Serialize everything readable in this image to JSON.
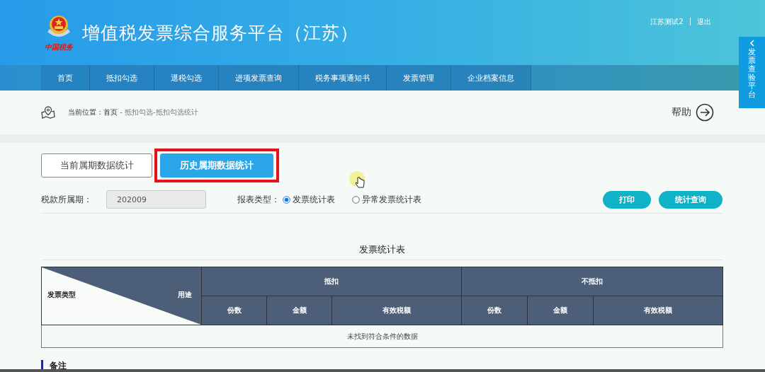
{
  "header": {
    "title": "增值税发票综合服务平台（江苏）",
    "logo_text": "中国税务",
    "user": "江苏测试2",
    "separator": "|",
    "logout": "退出"
  },
  "nav": [
    "首页",
    "抵扣勾选",
    "退税勾选",
    "进项发票查询",
    "税务事项通知书",
    "发票管理",
    "企业档案信息"
  ],
  "side_tab": {
    "label": "发票查验平台"
  },
  "breadcrumb": {
    "current": "当前位置：首页",
    "rest": " - 抵扣勾选-抵扣勾选统计"
  },
  "help": "帮助",
  "tabs": [
    {
      "label": "当前属期数据统计",
      "selected": false
    },
    {
      "label": "历史属期数据统计",
      "selected": true
    }
  ],
  "filters": {
    "period_label": "税款所属期：",
    "period_value": "202009",
    "report_type_label": "报表类型：",
    "report_types": [
      {
        "label": "发票统计表",
        "selected": true
      },
      {
        "label": "异常发票统计表",
        "selected": false
      }
    ]
  },
  "buttons": [
    "打印",
    "统计查询"
  ],
  "table": {
    "title": "发票统计表",
    "corner_left": "发票类型",
    "corner_right": "用途",
    "groups": [
      {
        "label": "抵扣",
        "columns": [
          "份数",
          "金额",
          "有效税额"
        ]
      },
      {
        "label": "不抵扣",
        "columns": [
          "份数",
          "金额",
          "有效税额"
        ]
      }
    ],
    "empty_message": "未找到符合条件的数据"
  },
  "remarks": {
    "title": "备注"
  }
}
